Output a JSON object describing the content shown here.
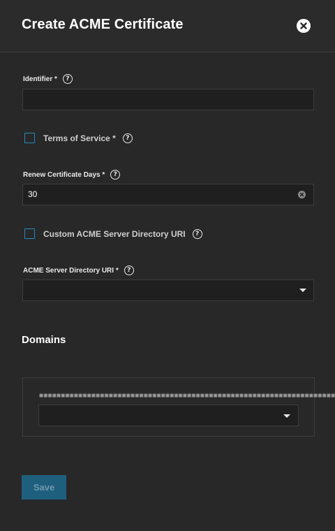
{
  "dialog": {
    "title": "Create ACME Certificate"
  },
  "form": {
    "identifier": {
      "label": "Identifier *",
      "value": ""
    },
    "terms_of_service": {
      "label": "Terms of Service *",
      "checked": false
    },
    "renew_days": {
      "label": "Renew Certificate Days *",
      "value": "30"
    },
    "custom_acme_uri": {
      "label": "Custom ACME Server Directory URI",
      "checked": false
    },
    "acme_uri": {
      "label": "ACME Server Directory URI *",
      "value": ""
    }
  },
  "domains": {
    "title": "Domains",
    "select_value": ""
  },
  "actions": {
    "save_label": "Save"
  },
  "colors": {
    "background": "#282828",
    "input_bg": "#1f1f1f",
    "accent": "#1f8ec0",
    "save_disabled": "#1f5f7e"
  },
  "icons": {
    "close": "close-circle-icon",
    "help": "help-circle-icon",
    "clear": "clear-circle-icon",
    "dropdown": "caret-down-icon"
  }
}
